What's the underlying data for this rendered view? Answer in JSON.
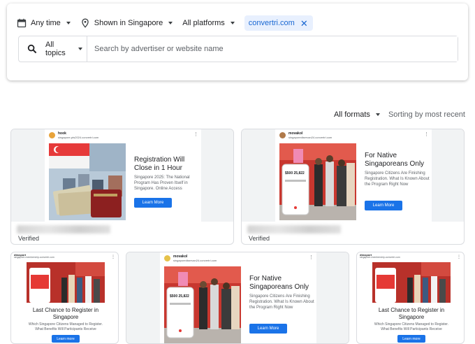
{
  "filters": {
    "time_label": "Any time",
    "region_label": "Shown in Singapore",
    "platforms_label": "All platforms",
    "domain_chip": "convertri.com",
    "chip_close": "✕"
  },
  "search": {
    "topics_label": "All topics",
    "placeholder": "Search by advertiser or website name"
  },
  "sort": {
    "formats_label": "All formats",
    "sorting_label": "Sorting by most recent"
  },
  "ads": [
    {
      "advertiser": "hook",
      "url": "singapore-pts2024.convertri.com",
      "title": "Registration Will Close in 1 Hour",
      "body": "Singapore 2025: The National Program Has Proven Itself in Singapore. Online Access",
      "cta": "Learn More",
      "status": "Verified"
    },
    {
      "advertiser": "movakol",
      "url": "singaporediservan24.convertri.com",
      "title": "For Native Singaporeans Only",
      "body": "Singapore Citizens Are Finishing Registration. What Is Known About the Program Right Now",
      "cta": "Learn More",
      "status": "Verified"
    },
    {
      "advertiser": "dbssport",
      "url": "singapore-membership.convertri.com",
      "title": "Last Chance to Register in Singapore",
      "body": "Which Singapore Citizens Managed to Register. What Benefits Will Participants Receive",
      "cta": "Learn more"
    },
    {
      "advertiser": "movakol",
      "url": "singaporediservan24.convertri.com",
      "title": "For Native Singaporeans Only",
      "body": "Singapore Citizens Are Finishing Registration. What Is Known About the Program Right Now",
      "cta": "Learn More"
    },
    {
      "advertiser": "dbssport",
      "url": "singapore-membership.convertri.com",
      "title": "Last Chance to Register in Singapore",
      "body": "Which Singapore Citizens Managed to Register. What Benefits Will Participants Receive",
      "cta": "Learn more"
    }
  ],
  "phone": {
    "amount": "$500 25,822"
  },
  "colors": {
    "accent": "#1a73e8",
    "chip_bg": "#e8f0fe",
    "chip_text": "#1967d2"
  }
}
